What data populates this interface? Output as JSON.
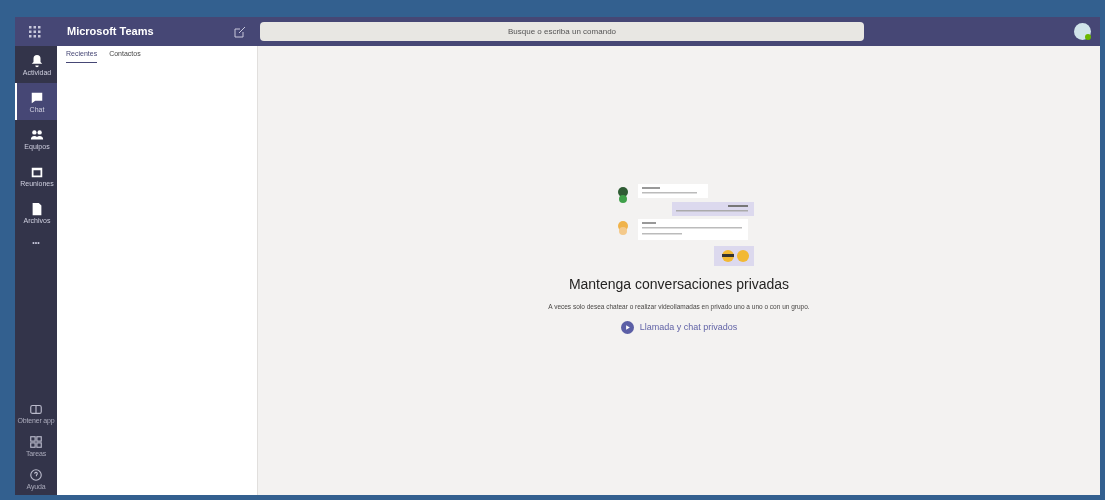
{
  "app_title": "Microsoft Teams",
  "search": {
    "placeholder": "Busque o escriba un comando"
  },
  "rail": [
    {
      "label": "Actividad",
      "kind": "bell",
      "selected": false
    },
    {
      "label": "Chat",
      "kind": "chat",
      "selected": true
    },
    {
      "label": "Equipos",
      "kind": "people",
      "selected": false
    },
    {
      "label": "Reuniones",
      "kind": "calendar",
      "selected": false
    },
    {
      "label": "Archivos",
      "kind": "file",
      "selected": false
    }
  ],
  "rail_more": "•••",
  "rail_bottom": [
    {
      "label": "Obtener app",
      "kind": "store"
    },
    {
      "label": "Tareas",
      "kind": "apps"
    },
    {
      "label": "Ayuda",
      "kind": "help"
    }
  ],
  "tabs": [
    {
      "label": "Recientes",
      "selected": true
    },
    {
      "label": "Contactos",
      "selected": false
    }
  ],
  "empty_state": {
    "title": "Mantenga conversaciones privadas",
    "description": "A veces solo desea chatear o realizar videollamadas en privado uno a uno o con un grupo.",
    "action": "Llamada y chat privados"
  }
}
